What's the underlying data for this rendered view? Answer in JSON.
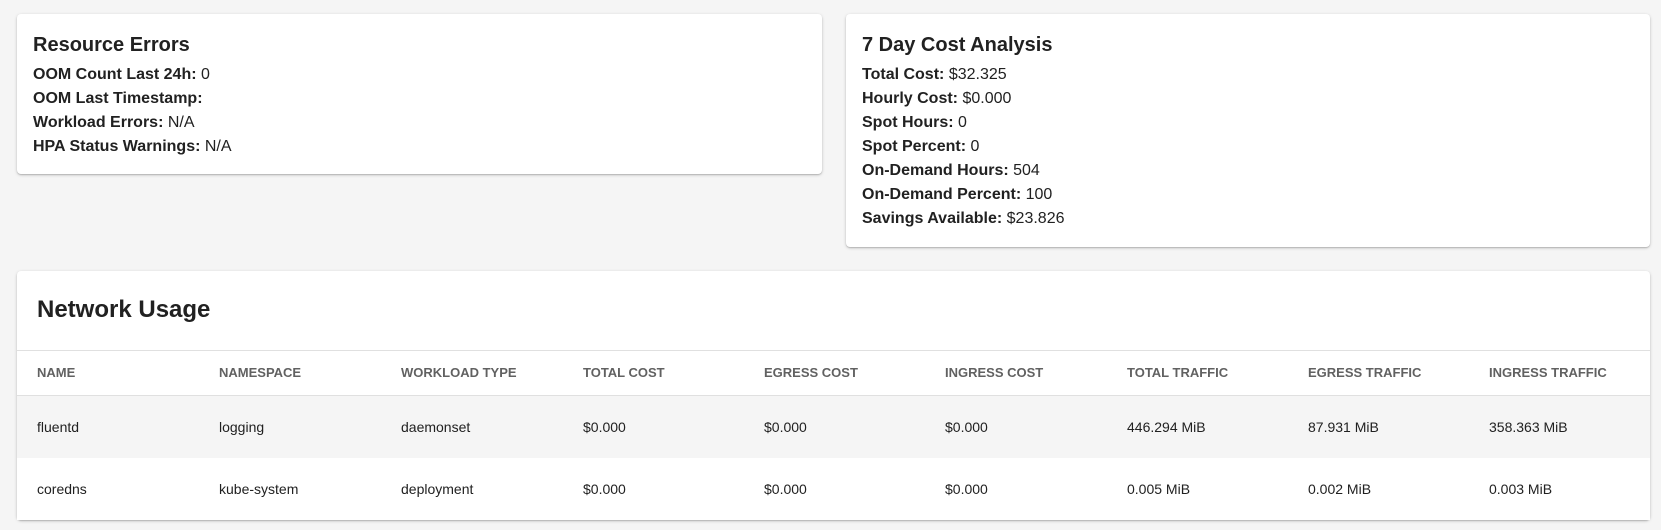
{
  "resource_errors": {
    "title": "Resource Errors",
    "stats": [
      {
        "label": "OOM Count Last 24h:",
        "value": "0"
      },
      {
        "label": "OOM Last Timestamp:",
        "value": ""
      },
      {
        "label": "Workload Errors:",
        "value": "N/A"
      },
      {
        "label": "HPA Status Warnings:",
        "value": "N/A"
      }
    ]
  },
  "cost_analysis": {
    "title": "7 Day Cost Analysis",
    "stats": [
      {
        "label": "Total Cost:",
        "value": "$32.325"
      },
      {
        "label": "Hourly Cost:",
        "value": "$0.000"
      },
      {
        "label": "Spot Hours:",
        "value": "0"
      },
      {
        "label": "Spot Percent:",
        "value": "0"
      },
      {
        "label": "On-Demand Hours:",
        "value": "504"
      },
      {
        "label": "On-Demand Percent:",
        "value": "100"
      },
      {
        "label": "Savings Available:",
        "value": "$23.826"
      }
    ]
  },
  "network_usage": {
    "title": "Network Usage",
    "columns": [
      "Name",
      "Namespace",
      "Workload Type",
      "Total Cost",
      "Egress Cost",
      "Ingress Cost",
      "Total Traffic",
      "Egress Traffic",
      "Ingress Traffic"
    ],
    "rows": [
      [
        "fluentd",
        "logging",
        "daemonset",
        "$0.000",
        "$0.000",
        "$0.000",
        "446.294 MiB",
        "87.931 MiB",
        "358.363 MiB"
      ],
      [
        "coredns",
        "kube-system",
        "deployment",
        "$0.000",
        "$0.000",
        "$0.000",
        "0.005 MiB",
        "0.002 MiB",
        "0.003 MiB"
      ]
    ]
  }
}
